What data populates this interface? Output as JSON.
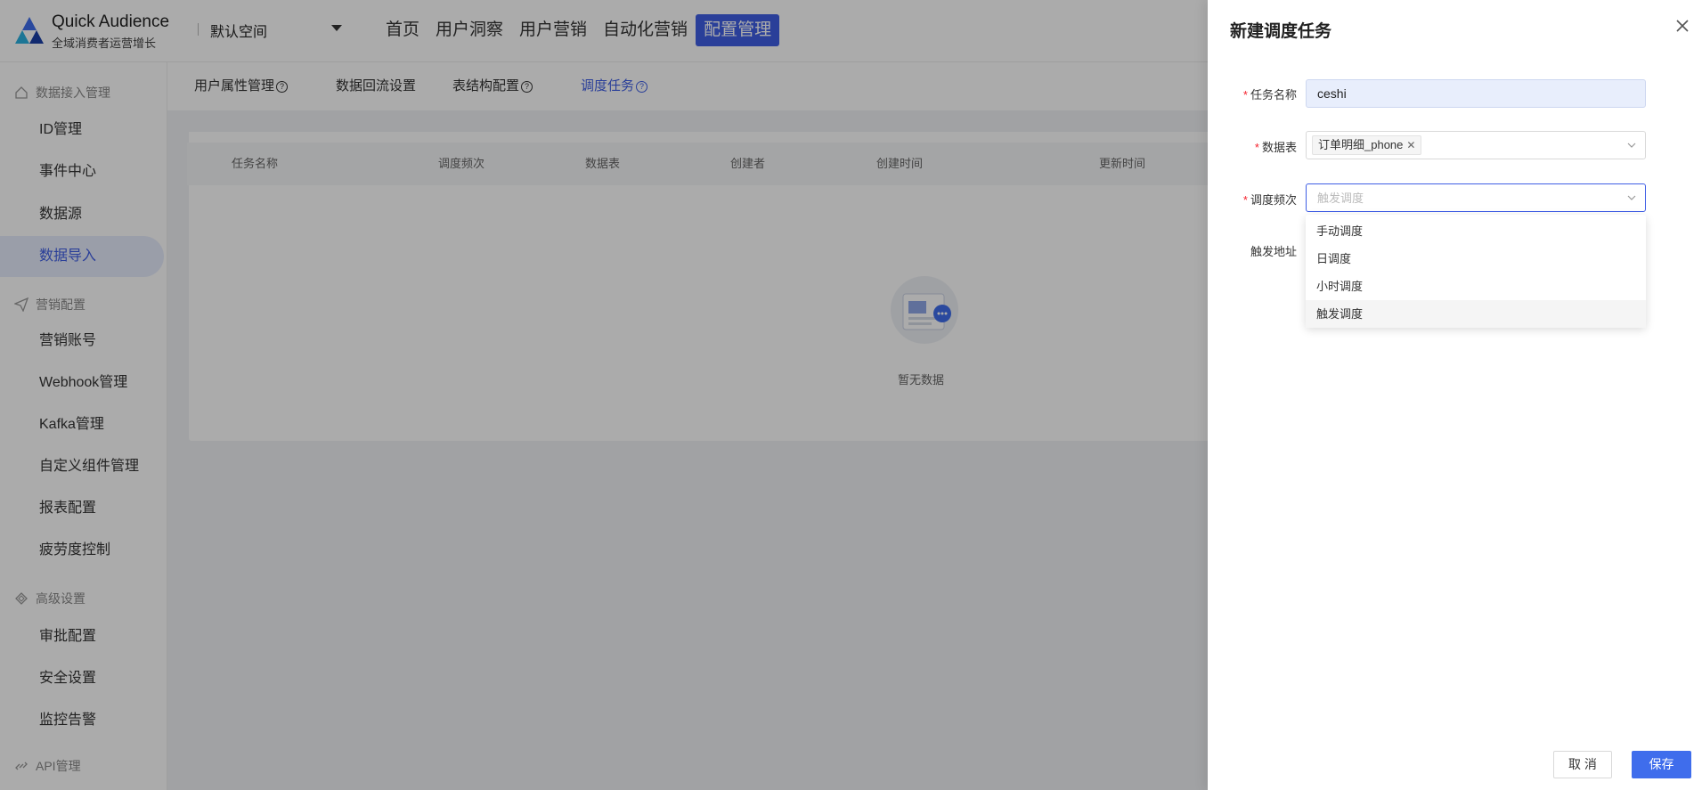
{
  "header": {
    "brand_title": "Quick Audience",
    "brand_subtitle": "全域消费者运营增长",
    "workspace": "默认空间",
    "nav": [
      "首页",
      "用户洞察",
      "用户营销",
      "自动化营销",
      "配置管理"
    ],
    "accent_color": "#3f5ee5"
  },
  "sidebar": {
    "groups": [
      {
        "title": "数据接入管理",
        "icon": "house-icon",
        "items": [
          "ID管理",
          "事件中心",
          "数据源",
          "数据导入"
        ]
      },
      {
        "title": "营销配置",
        "icon": "send-icon",
        "items": [
          "营销账号",
          "Webhook管理",
          "Kafka管理",
          "自定义组件管理",
          "报表配置",
          "疲劳度控制"
        ]
      },
      {
        "title": "高级设置",
        "icon": "layers-icon",
        "items": [
          "审批配置",
          "安全设置",
          "监控告警"
        ]
      },
      {
        "title": "API管理",
        "icon": "link-icon",
        "items": []
      }
    ],
    "active_item": "数据导入"
  },
  "main": {
    "tabs": [
      "用户属性管理",
      "数据回流设置",
      "表结构配置",
      "调度任务"
    ],
    "active_tab": "调度任务",
    "table_headers": [
      "任务名称",
      "调度频次",
      "数据表",
      "创建者",
      "创建时间",
      "更新时间"
    ],
    "empty_text": "暂无数据"
  },
  "drawer": {
    "title": "新建调度任务",
    "fields": {
      "task_name": {
        "label": "任务名称",
        "value": "ceshi"
      },
      "data_table": {
        "label": "数据表",
        "tag": "订单明细_phone"
      },
      "frequency": {
        "label": "调度频次",
        "placeholder": "触发调度"
      },
      "trigger_url": {
        "label": "触发地址"
      }
    },
    "frequency_options": [
      "手动调度",
      "日调度",
      "小时调度",
      "触发调度"
    ],
    "hovered_option": "触发调度",
    "cancel_label": "取 消",
    "save_label": "保存"
  }
}
